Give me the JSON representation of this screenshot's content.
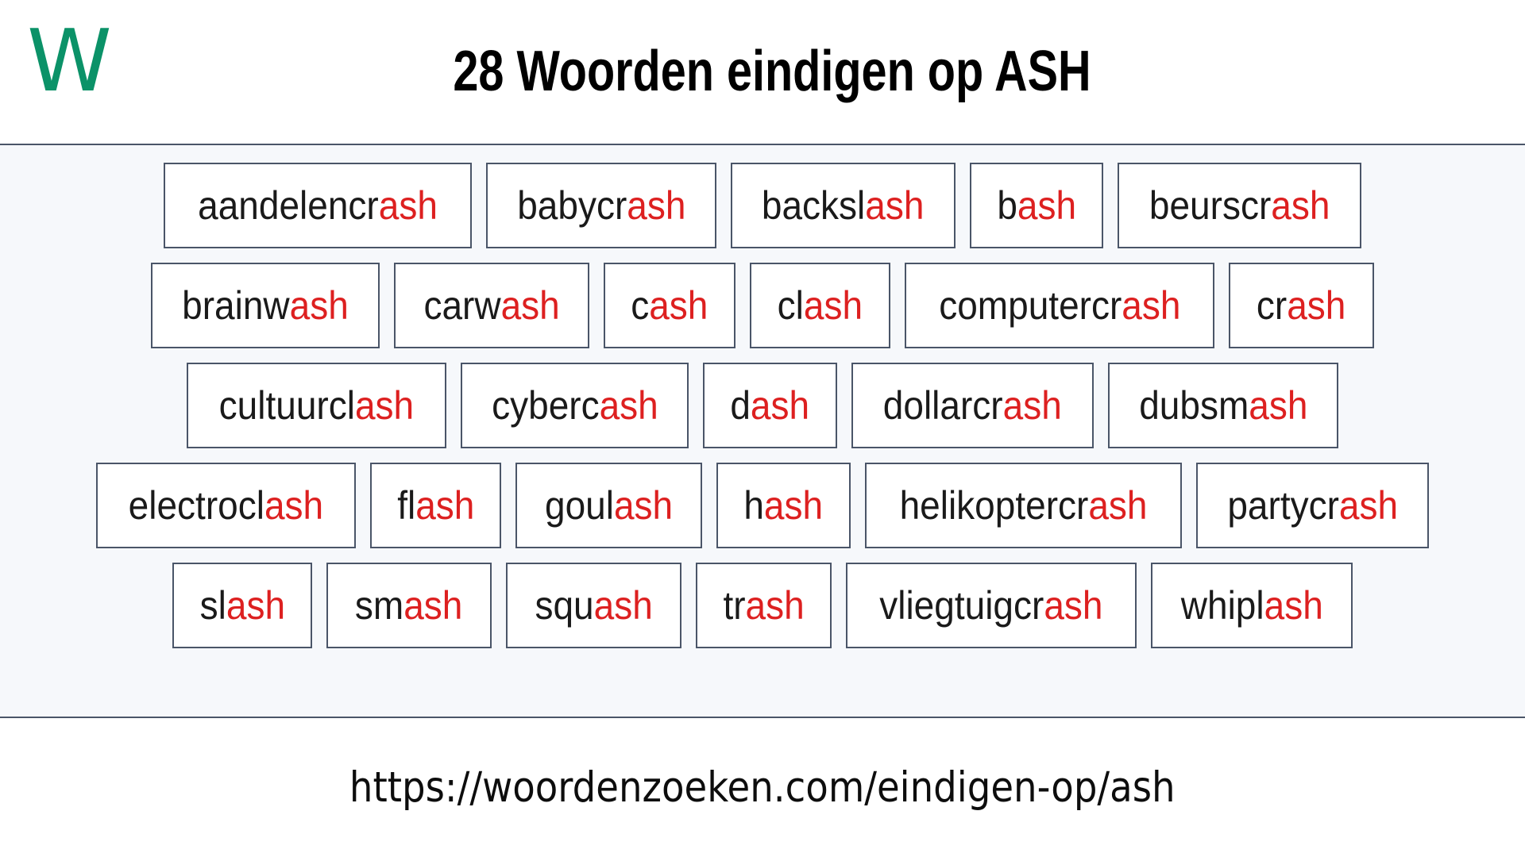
{
  "header": {
    "logo_text": "W",
    "logo_color": "#0b9268",
    "title": "28 Woorden eindigen op ASH"
  },
  "board": {
    "highlight_color": "#dd2020",
    "box_border_color": "#4a5568",
    "background_color": "#f6f8fb",
    "suffix": "ash",
    "word_count": 28,
    "rows": [
      [
        {
          "word": "aandelencrash",
          "prefix": "aandelencr",
          "suffix": "ash"
        },
        {
          "word": "babycrash",
          "prefix": "babycr",
          "suffix": "ash"
        },
        {
          "word": "backslash",
          "prefix": "backsl",
          "suffix": "ash"
        },
        {
          "word": "bash",
          "prefix": "b",
          "suffix": "ash"
        },
        {
          "word": "beurscrash",
          "prefix": "beurscr",
          "suffix": "ash"
        }
      ],
      [
        {
          "word": "brainwash",
          "prefix": "brainw",
          "suffix": "ash"
        },
        {
          "word": "carwash",
          "prefix": "carw",
          "suffix": "ash"
        },
        {
          "word": "cash",
          "prefix": "c",
          "suffix": "ash"
        },
        {
          "word": "clash",
          "prefix": "cl",
          "suffix": "ash"
        },
        {
          "word": "computercrash",
          "prefix": "computercr",
          "suffix": "ash"
        },
        {
          "word": "crash",
          "prefix": "cr",
          "suffix": "ash"
        }
      ],
      [
        {
          "word": "cultuurclash",
          "prefix": "cultuurcl",
          "suffix": "ash"
        },
        {
          "word": "cybercash",
          "prefix": "cyberc",
          "suffix": "ash"
        },
        {
          "word": "dash",
          "prefix": "d",
          "suffix": "ash"
        },
        {
          "word": "dollarcrash",
          "prefix": "dollarcr",
          "suffix": "ash"
        },
        {
          "word": "dubsmash",
          "prefix": "dubsm",
          "suffix": "ash"
        }
      ],
      [
        {
          "word": "electroclash",
          "prefix": "electrocl",
          "suffix": "ash"
        },
        {
          "word": "flash",
          "prefix": "fl",
          "suffix": "ash"
        },
        {
          "word": "goulash",
          "prefix": "goul",
          "suffix": "ash"
        },
        {
          "word": "hash",
          "prefix": "h",
          "suffix": "ash"
        },
        {
          "word": "helikoptercrash",
          "prefix": "helikoptercr",
          "suffix": "ash"
        },
        {
          "word": "partycrash",
          "prefix": "partycr",
          "suffix": "ash"
        }
      ],
      [
        {
          "word": "slash",
          "prefix": "sl",
          "suffix": "ash"
        },
        {
          "word": "smash",
          "prefix": "sm",
          "suffix": "ash"
        },
        {
          "word": "squash",
          "prefix": "squ",
          "suffix": "ash"
        },
        {
          "word": "trash",
          "prefix": "tr",
          "suffix": "ash"
        },
        {
          "word": "vliegtuigcrash",
          "prefix": "vliegtuigcr",
          "suffix": "ash"
        },
        {
          "word": "whiplash",
          "prefix": "whipl",
          "suffix": "ash"
        }
      ]
    ]
  },
  "footer": {
    "url": "https://woordenzoeken.com/eindigen-op/ash"
  }
}
